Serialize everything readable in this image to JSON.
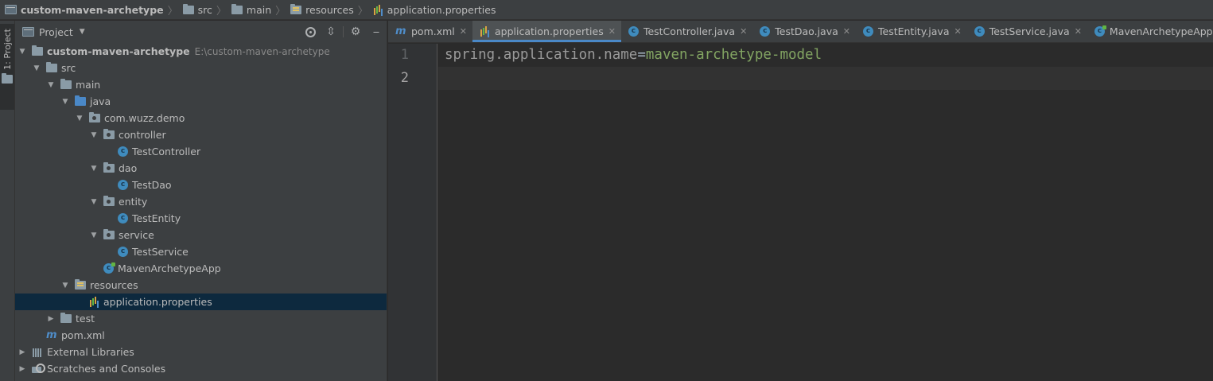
{
  "breadcrumb": [
    {
      "label": "custom-maven-archetype",
      "icon": "project-folder-icon"
    },
    {
      "label": "src",
      "icon": "folder-icon"
    },
    {
      "label": "main",
      "icon": "folder-icon"
    },
    {
      "label": "resources",
      "icon": "resources-folder-icon"
    },
    {
      "label": "application.properties",
      "icon": "properties-file-icon"
    }
  ],
  "tool_stripe": {
    "project_tab": "1: Project"
  },
  "project_panel": {
    "title": "Project",
    "tree": {
      "root": {
        "label": "custom-maven-archetype",
        "path": "E:\\custom-maven-archetype"
      },
      "src": "src",
      "main": "main",
      "java": "java",
      "package": "com.wuzz.demo",
      "controller": "controller",
      "test_controller": "TestController",
      "dao": "dao",
      "test_dao": "TestDao",
      "entity": "entity",
      "test_entity": "TestEntity",
      "service": "service",
      "test_service": "TestService",
      "app": "MavenArchetypeApp",
      "resources": "resources",
      "properties": "application.properties",
      "test": "test",
      "pom": "pom.xml",
      "external_libraries": "External Libraries",
      "scratches": "Scratches and Consoles"
    }
  },
  "editor": {
    "tabs": [
      {
        "label": "pom.xml",
        "icon": "maven-icon"
      },
      {
        "label": "application.properties",
        "icon": "properties-file-icon",
        "active": true
      },
      {
        "label": "TestController.java",
        "icon": "class-icon"
      },
      {
        "label": "TestDao.java",
        "icon": "class-icon"
      },
      {
        "label": "TestEntity.java",
        "icon": "class-icon"
      },
      {
        "label": "TestService.java",
        "icon": "class-icon"
      },
      {
        "label": "MavenArchetypeApp.java",
        "icon": "main-class-icon"
      }
    ],
    "lines": [
      {
        "number": "1",
        "key": "spring.application.name",
        "eq": "=",
        "value": "maven-archetype-model"
      },
      {
        "number": "2",
        "key": "",
        "eq": "",
        "value": ""
      }
    ]
  },
  "colors": {
    "background": "#2b2b2b",
    "panel": "#3c3f41",
    "selection": "#0d293e",
    "accent": "#4a88c7",
    "string_value": "#6a8759"
  }
}
